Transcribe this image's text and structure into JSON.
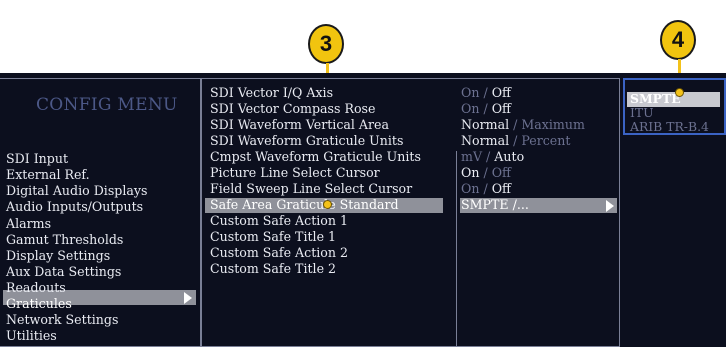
{
  "callouts": {
    "c3": "3",
    "c4": "4"
  },
  "config_menu": {
    "title": "CONFIG MENU",
    "items": [
      "SDI Input",
      "External Ref.",
      "Digital Audio Displays",
      "Audio Inputs/Outputs",
      "Alarms",
      "Gamut Thresholds",
      "Display Settings",
      "Aux Data Settings",
      "Readouts",
      "Graticules",
      "Network Settings",
      "Utilities"
    ],
    "selected": "Graticules"
  },
  "graticules_menu": {
    "items": [
      "SDI Vector I/Q Axis",
      "SDI Vector Compass Rose",
      "SDI Waveform Vertical Area",
      "SDI Waveform Graticule Units",
      "Cmpst Waveform Graticule Units",
      "Picture Line Select Cursor",
      "Field Sweep Line Select Cursor",
      "Safe Area Graticule Standard",
      "Custom Safe Action 1",
      "Custom Safe Title  1",
      "Custom Safe Action 2",
      "Custom Safe Title  2"
    ],
    "selected": "Safe Area Graticule Standard"
  },
  "values": [
    {
      "a": "On",
      "sep": " / ",
      "b": "Off",
      "active": "b"
    },
    {
      "a": "On",
      "sep": " / ",
      "b": "Off",
      "active": "b"
    },
    {
      "a": "Normal",
      "sep": " / ",
      "b": "Maximum",
      "active": "a"
    },
    {
      "a": "Normal",
      "sep": " / ",
      "b": "Percent",
      "active": "a"
    },
    {
      "a": "mV",
      "sep": " / ",
      "b": "Auto",
      "active": "b"
    },
    {
      "a": "On",
      "sep": " / ",
      "b": "Off",
      "active": "a"
    },
    {
      "a": "On",
      "sep": " / ",
      "b": "Off",
      "active": "b"
    },
    {
      "a": "SMPTE /...",
      "sep": "",
      "b": "",
      "active": "a"
    }
  ],
  "standard_options": {
    "items": [
      "SMPTE",
      "ITU",
      "ARIB TR-B.4"
    ],
    "selected": "SMPTE"
  },
  "colors": {
    "background": "#0c0f1e",
    "highlight": "#8f919a",
    "callout": "#f1c40f",
    "submenu_border": "#3b63c4"
  }
}
